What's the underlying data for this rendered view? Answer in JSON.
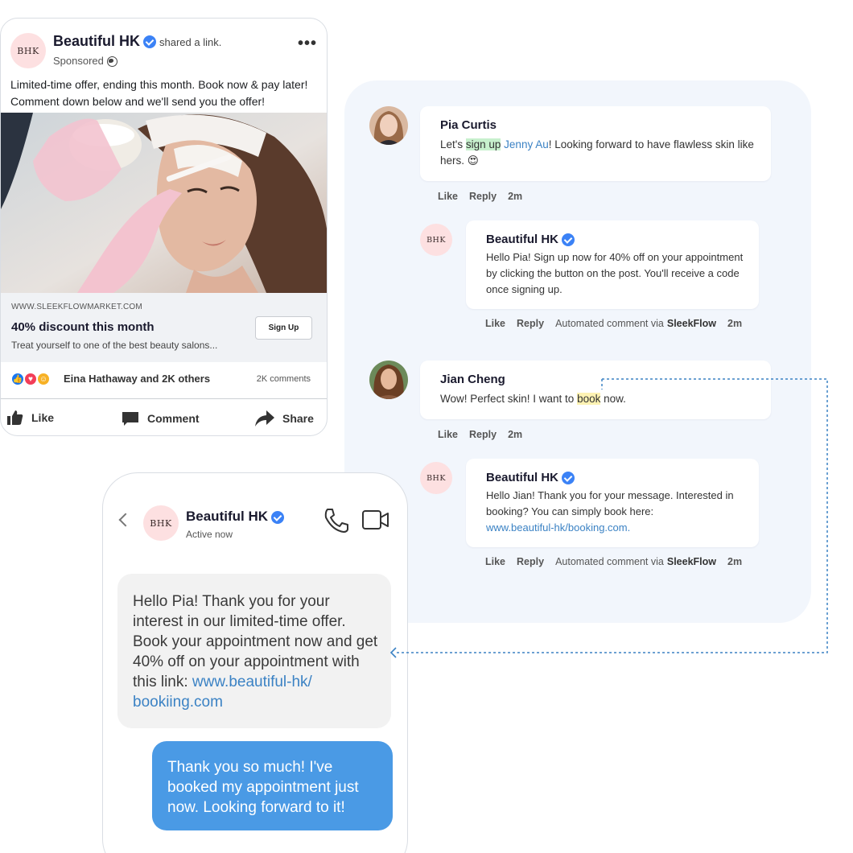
{
  "post": {
    "page_name": "Beautiful HK",
    "avatar_text": "BHK",
    "shared_text": "shared a link.",
    "sponsored": "Sponsored",
    "body": "Limited-time offer, ending this month. Book now & pay later! Comment down below and we'll send you the offer!",
    "link": {
      "domain": "WWW.SLEEKFLOWMARKET.COM",
      "title": "40% discount this month",
      "subtitle": "Treat yourself to one of the best beauty salons...",
      "cta": "Sign Up"
    },
    "reactions_text": "Eina Hathaway and 2K others",
    "comment_count": "2K comments",
    "actions": {
      "like": "Like",
      "comment": "Comment",
      "share": "Share"
    }
  },
  "comments": {
    "c1": {
      "author": "Pia Curtis",
      "text_pre": "Let's ",
      "highlight": "sign up",
      "mention": "Jenny Au",
      "text_post": "! Looking forward to have flawless skin like hers. 😍",
      "like": "Like",
      "reply": "Reply",
      "time": "2m"
    },
    "r1": {
      "author": "Beautiful HK",
      "text": "Hello Pia! Sign up now for 40% off on your appointment by clicking the button on the post. You'll receive a code once signing up.",
      "like": "Like",
      "reply": "Reply",
      "automated": "Automated comment via",
      "brand": "SleekFlow",
      "time": "2m"
    },
    "c2": {
      "author": "Jian Cheng",
      "text_pre": "Wow! Perfect skin! I want to ",
      "highlight": "book",
      "text_post": " now.",
      "like": "Like",
      "reply": "Reply",
      "time": "2m"
    },
    "r2": {
      "author": "Beautiful HK",
      "text": "Hello Jian! Thank you for your message. Interested in booking? You can simply book here:",
      "link": "www.beautiful-hk/booking.com.",
      "like": "Like",
      "reply": "Reply",
      "automated": "Automated comment via",
      "brand": "SleekFlow",
      "time": "2m"
    }
  },
  "messenger": {
    "name": "Beautiful HK",
    "status": "Active now",
    "avatar_text": "BHK",
    "incoming_text": "Hello Pia! Thank you for your interest in our limited-time offer. Book your appointment now and get 40% off on your appointment with this link: ",
    "incoming_link": "www.beautiful-hk/ bookiing.com",
    "outgoing_text": "Thank you so much! I've booked my appointment just now. Looking forward to it!"
  },
  "colors": {
    "verified": "#3b82f6",
    "panel_bg": "#f2f6fc",
    "outgoing_bubble": "#4a9ae5",
    "highlight_green": "#c7f0cd",
    "highlight_yellow": "#fdf2b3",
    "link": "#3b82c4"
  }
}
